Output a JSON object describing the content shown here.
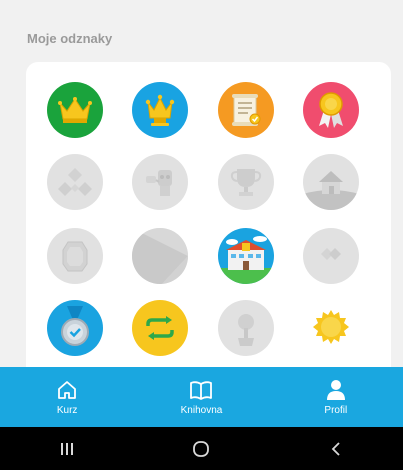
{
  "section": {
    "title": "Moje odznaky"
  },
  "badges": [
    {
      "name": "crown-green",
      "bg": "#1aa33c",
      "state": "earned"
    },
    {
      "name": "crown-blue",
      "bg": "#19a3e2",
      "state": "earned"
    },
    {
      "name": "certificate",
      "bg": "#f59a22",
      "state": "earned"
    },
    {
      "name": "ribbon-award",
      "bg": "#f04d6e",
      "state": "earned"
    },
    {
      "name": "diamond-arrows",
      "state": "locked"
    },
    {
      "name": "robot",
      "state": "locked"
    },
    {
      "name": "trophy",
      "state": "locked"
    },
    {
      "name": "house",
      "state": "locked"
    },
    {
      "name": "gem",
      "state": "locked"
    },
    {
      "name": "geometric",
      "state": "locked"
    },
    {
      "name": "school-building",
      "bg": "#1aa3e0",
      "state": "earned"
    },
    {
      "name": "hearts",
      "state": "locked"
    },
    {
      "name": "medal",
      "bg": "#1aa3e0",
      "state": "earned"
    },
    {
      "name": "repeat",
      "bg": "#f7c61e",
      "state": "earned"
    },
    {
      "name": "money-tree",
      "state": "locked"
    },
    {
      "name": "sun",
      "bg": "#f7c61e",
      "state": "earned"
    }
  ],
  "tabbar": {
    "background": "#1aa7e0",
    "tabs": [
      {
        "label": "Kurz",
        "icon": "home-icon"
      },
      {
        "label": "Knihovna",
        "icon": "book-icon"
      },
      {
        "label": "Profil",
        "icon": "person-icon"
      }
    ]
  },
  "system_nav": {
    "buttons": [
      "recent-apps-icon",
      "home-circle-icon",
      "back-icon"
    ]
  }
}
